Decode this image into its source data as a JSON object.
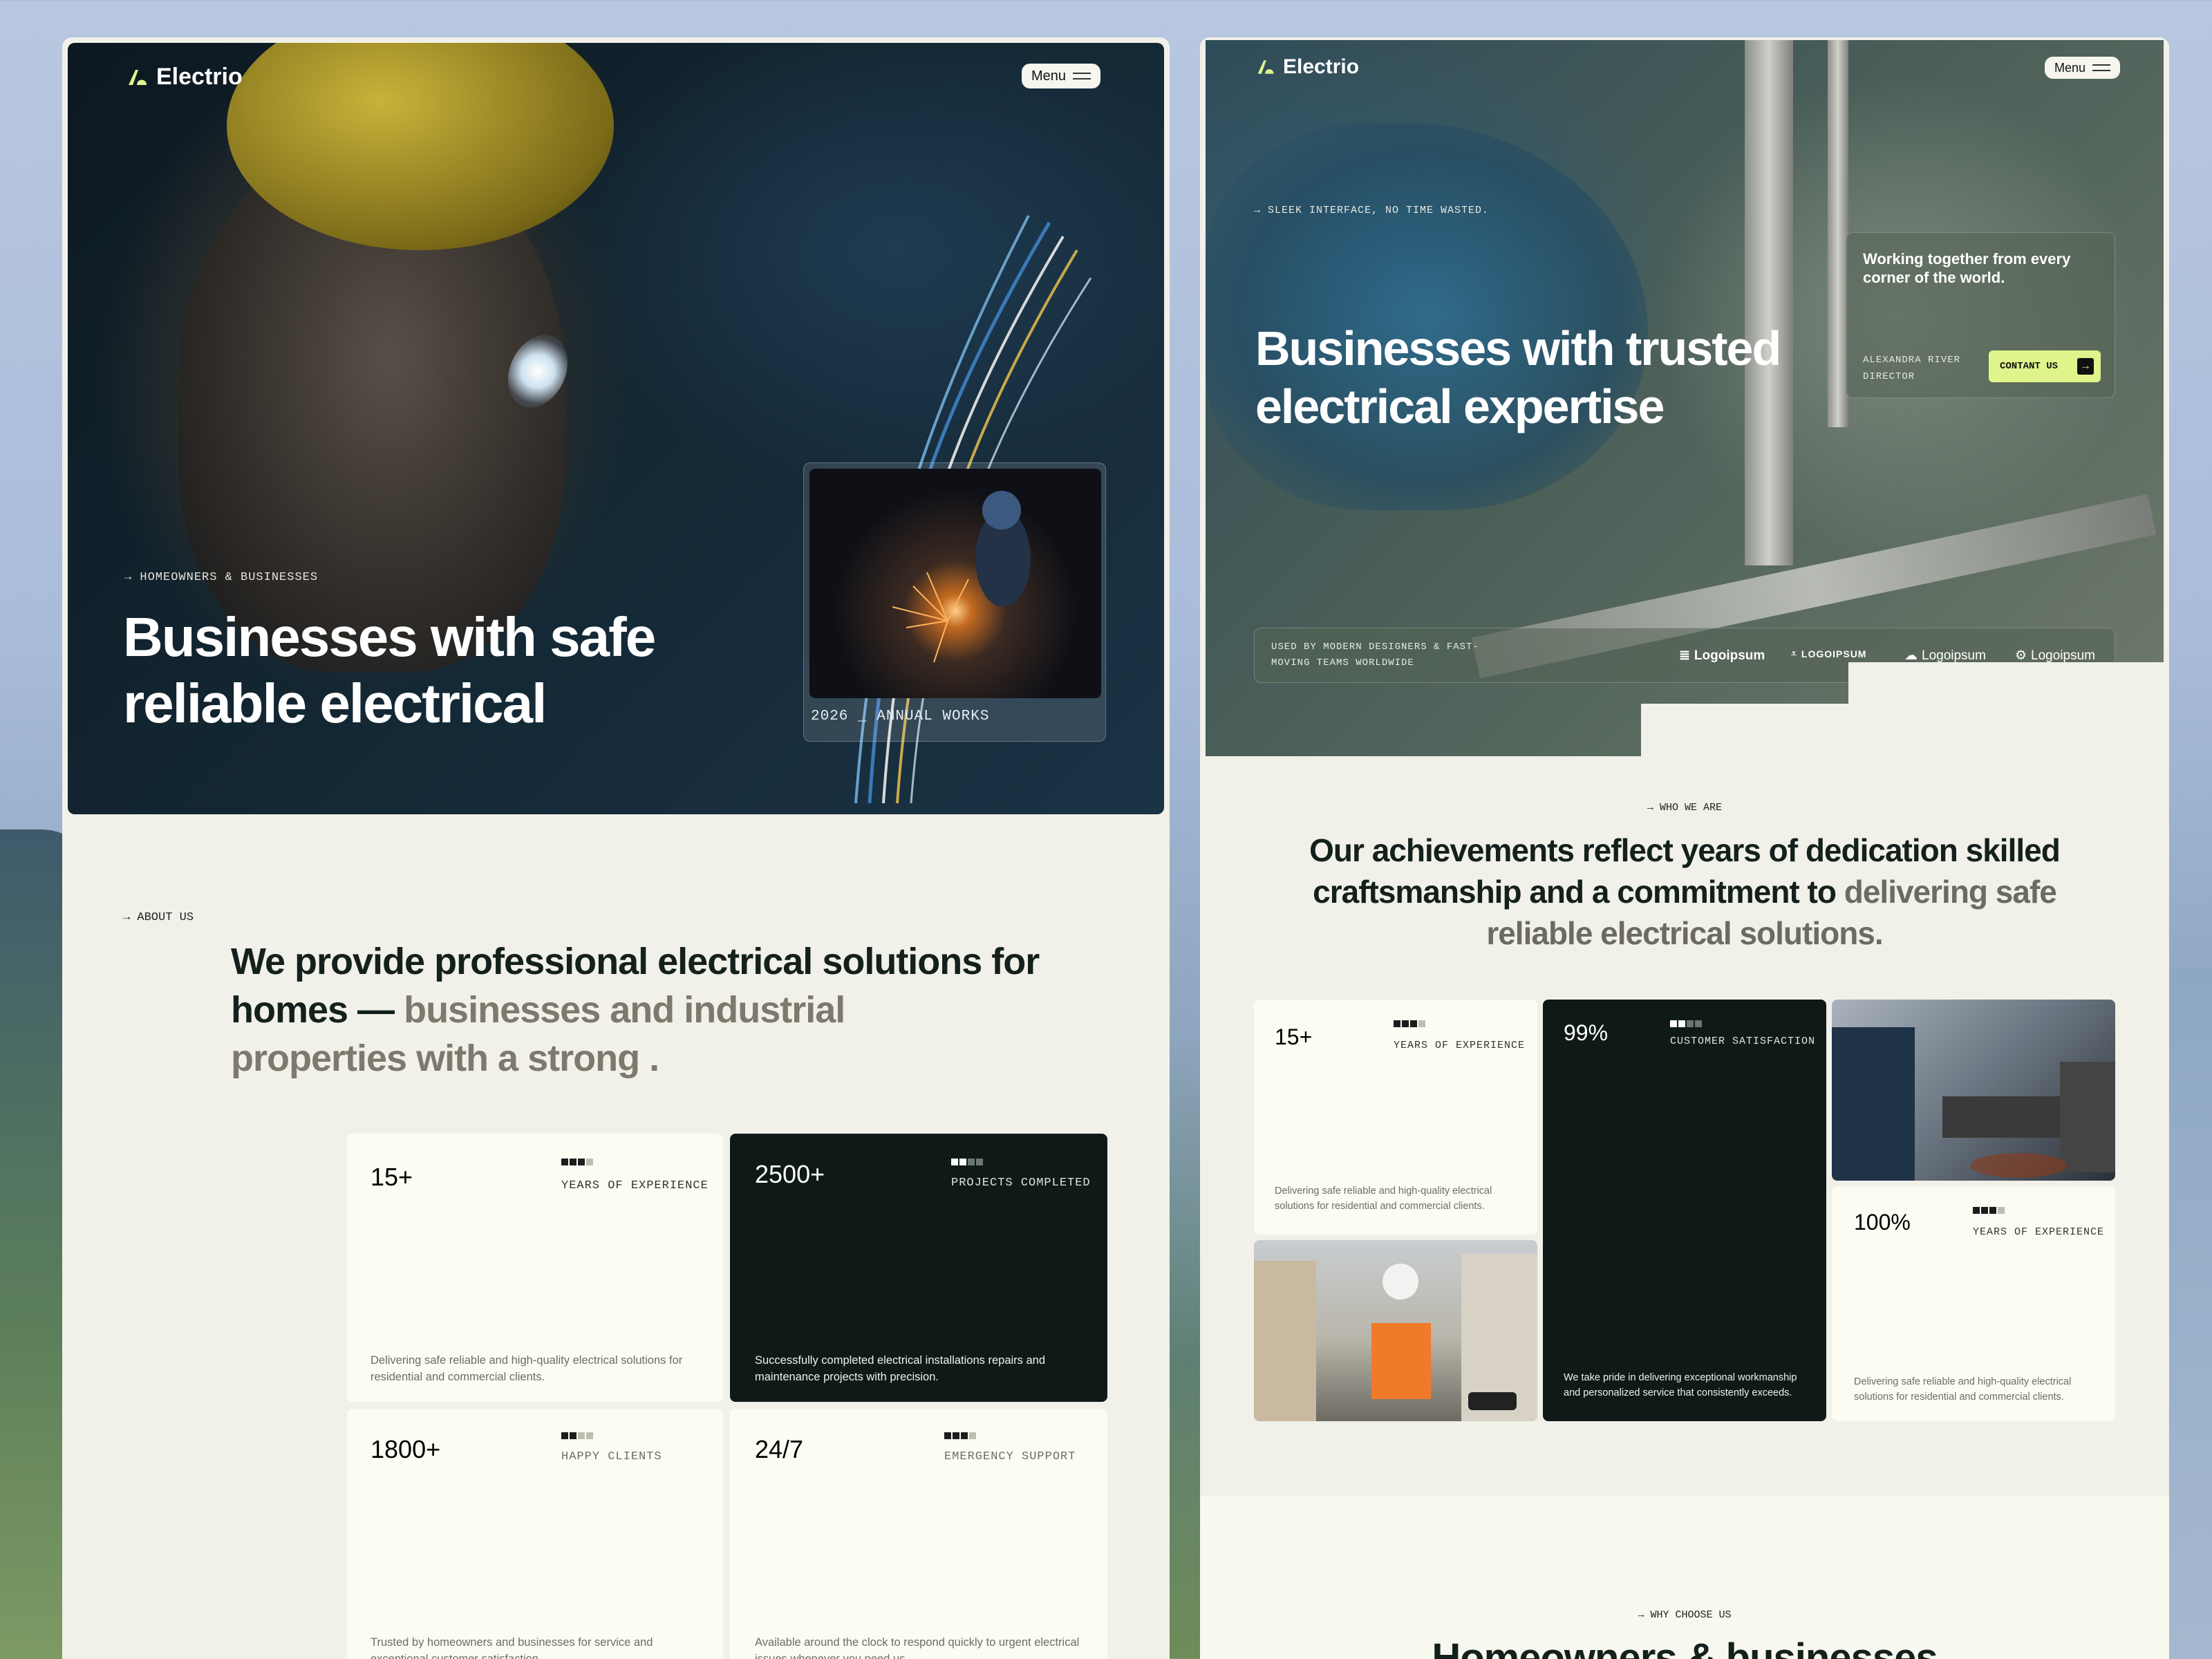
{
  "left": {
    "brand": "Electrio",
    "menu_label": "Menu",
    "hero": {
      "tag": "HOMEOWNERS & BUSINESSES",
      "title_line1": "Businesses with safe",
      "title_line2": "reliable electrical",
      "inset_caption": "2026 _ ANNUAL WORKS"
    },
    "about": {
      "tag": "ABOUT US",
      "lead_line1": "We provide professional electrical solutions for",
      "lead_line2_dark": "homes —",
      "lead_line2_muted": "businesses and industrial",
      "lead_line3_muted": "properties with a strong ."
    },
    "stats": [
      {
        "value": "15+",
        "label": "YEARS OF EXPERIENCE",
        "desc1": "Delivering safe reliable and high-quality electrical solutions for",
        "desc2": "residential and commercial clients."
      },
      {
        "value": "2500+",
        "label": "PROJECTS COMPLETED",
        "desc1": "Successfully completed electrical installations repairs and",
        "desc2": "maintenance projects with precision."
      },
      {
        "value": "1800+",
        "label": "HAPPY CLIENTS",
        "desc1": "Trusted by homeowners and businesses for  service and",
        "desc2": "exceptional customer satisfaction."
      },
      {
        "value": "24/7",
        "label": "EMERGENCY SUPPORT",
        "desc1": "Available around the clock to respond quickly to urgent electrical",
        "desc2": "issues whenever you need us."
      }
    ]
  },
  "right": {
    "brand": "Electrio",
    "menu_label": "Menu",
    "hero": {
      "tag": "SLEEK INTERFACE, NO TIME WASTED.",
      "title_line1": "Businesses with trusted",
      "title_line2": "electrical expertise",
      "quote_line1": "Working together from every",
      "quote_line2": "corner of the world.",
      "person_name": "ALEXANDRA RIVER",
      "person_role": "DIRECTOR",
      "contact_label": "CONTANT US",
      "used_by_line1": "USED BY MODERN DESIGNERS & FAST-",
      "used_by_line2": "MOVING TEAMS WORLDWIDE",
      "logos": [
        "Logoipsum",
        "LOGOIPSUM",
        "Logoipsum",
        "Logoipsum"
      ]
    },
    "who": {
      "tag": "WHO WE ARE",
      "line1": "Our achievements reflect years of dedication skilled",
      "line2_dark": "craftsmanship and a commitment to",
      "line2_muted": "delivering safe",
      "line3_muted": "reliable electrical solutions."
    },
    "stats": [
      {
        "value": "15+",
        "label": "YEARS OF EXPERIENCE",
        "desc1": "Delivering safe reliable and high-quality electrical",
        "desc2": "solutions for residential and commercial clients."
      },
      {
        "value": "99%",
        "label": "CUSTOMER SATISFACTION",
        "desc1": "We take pride in delivering exceptional workmanship",
        "desc2": "and personalized service that consistently exceeds."
      },
      {
        "value": "100%",
        "label": "YEARS OF EXPERIENCE",
        "desc1": "Delivering safe reliable and high-quality electrical",
        "desc2": "solutions for residential and commercial clients."
      }
    ],
    "why": {
      "tag": "WHY CHOOSE US",
      "title": "Homeowners & businesses"
    }
  },
  "colors": {
    "accent_lime": "#dff48a",
    "dark_card": "#0f1a18",
    "cream": "#fdfcf2",
    "panel_bg": "#f1f1e9"
  }
}
